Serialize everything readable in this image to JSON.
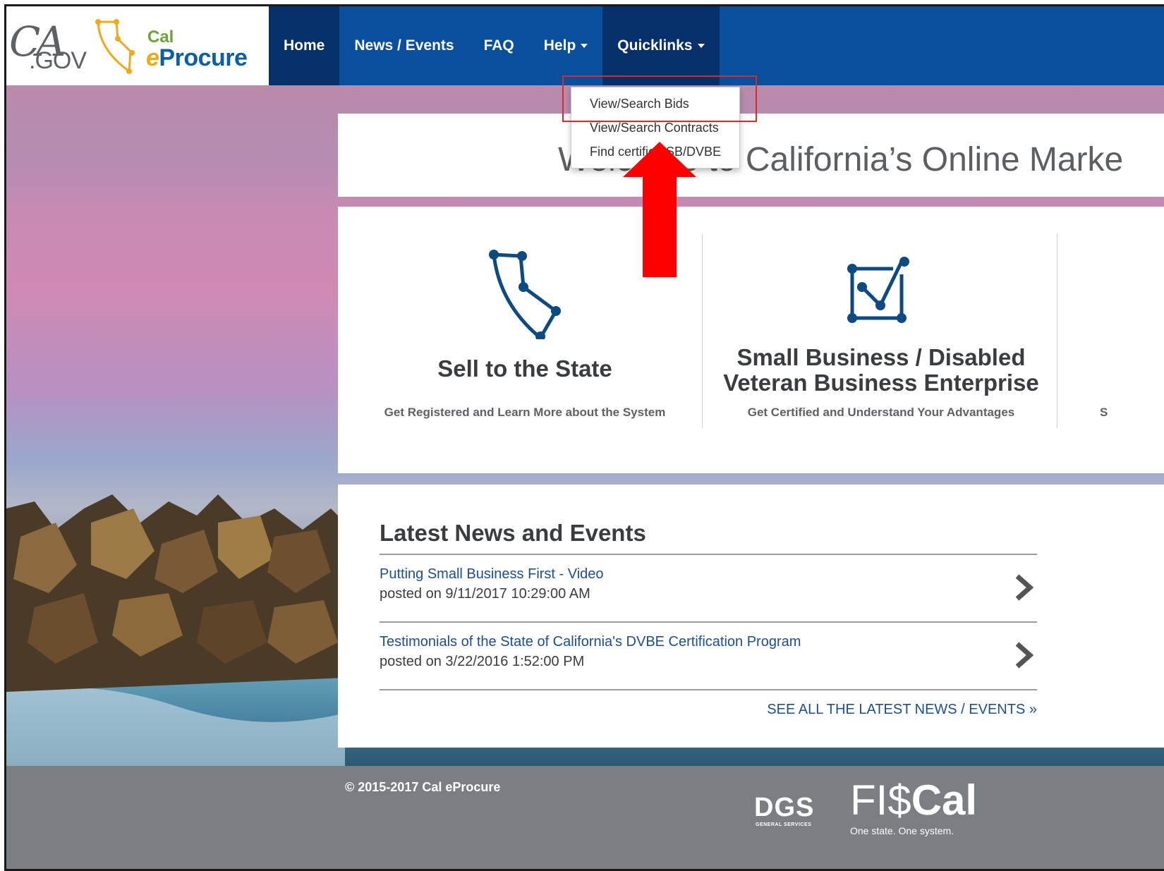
{
  "header": {
    "gov_script": "CA",
    "gov_suffix": ".GOV",
    "brand_cal": "Cal",
    "brand_e": "e",
    "brand_procure": "Procure"
  },
  "nav": {
    "items": [
      {
        "label": "Home"
      },
      {
        "label": "News / Events"
      },
      {
        "label": "FAQ"
      },
      {
        "label": "Help"
      },
      {
        "label": "Quicklinks"
      }
    ]
  },
  "quicklinks_menu": {
    "items": [
      {
        "label": "View/Search Bids"
      },
      {
        "label": "View/Search Contracts"
      },
      {
        "label": "Find certified SB/DVBE"
      }
    ]
  },
  "welcome": {
    "text": "Welcome to California’s Online Marke"
  },
  "features": [
    {
      "title": "Sell to the State",
      "subtitle": "Get Registered and Learn More about the System",
      "icon": "california-constellation-icon"
    },
    {
      "title_line1": "Small Business / Disabled",
      "title_line2": "Veteran Business Enterprise",
      "subtitle": "Get Certified and Understand Your Advantages",
      "icon": "network-square-icon"
    },
    {
      "subtitle_fragment": "S"
    }
  ],
  "news": {
    "heading": "Latest News and Events",
    "items": [
      {
        "title": "Putting Small Business First - Video",
        "posted": "posted on 9/11/2017 10:29:00 AM"
      },
      {
        "title": "Testimonials of the State of California's DVBE Certification Program",
        "posted": "posted on 3/22/2016 1:52:00 PM"
      }
    ],
    "see_all": "SEE ALL THE LATEST NEWS / EVENTS »"
  },
  "footer": {
    "copyright": "© 2015-2017 Cal eProcure",
    "dgs": "DGS",
    "dgs_sub": "GENERAL SERVICES",
    "fiscal_light": "FI$",
    "fiscal_bold": "Cal",
    "fiscal_tagline": "One state. One system."
  },
  "colors": {
    "nav_bg": "#0a4f9e",
    "nav_active": "#06306a",
    "link": "#1b4f8e",
    "annotation": "#ff0000",
    "footer_bg": "#7b7e82"
  }
}
